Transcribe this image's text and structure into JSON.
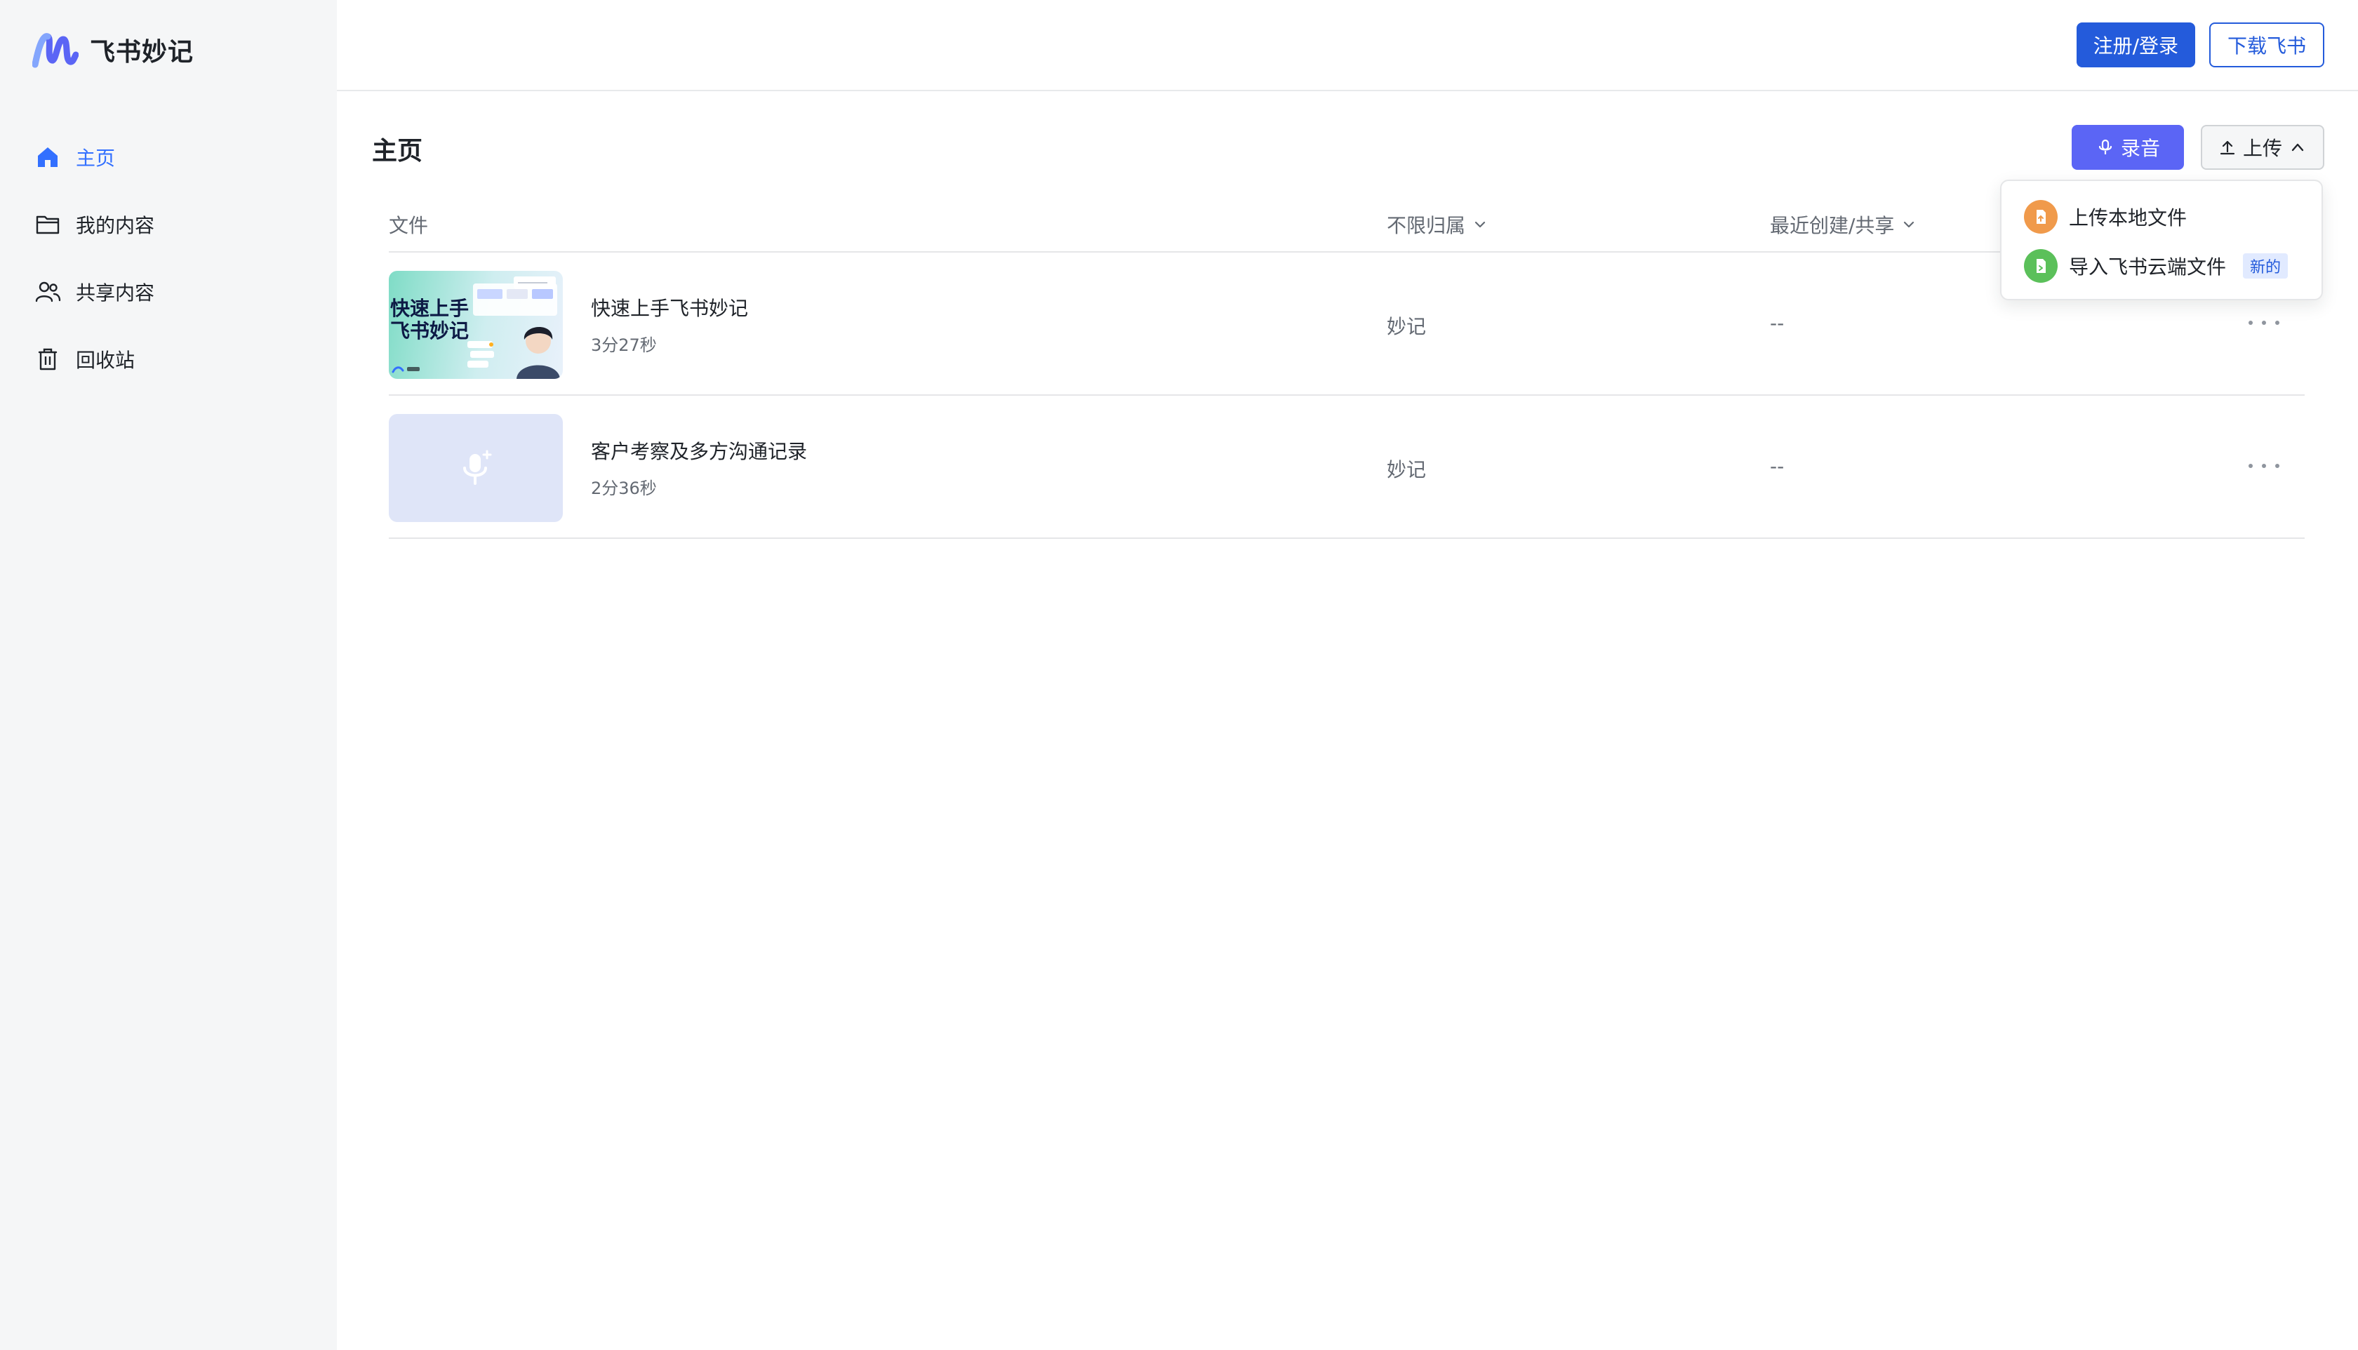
{
  "brand": {
    "name": "飞书妙记"
  },
  "sidebar": {
    "items": [
      {
        "label": "主页",
        "icon": "home-icon",
        "active": true
      },
      {
        "label": "我的内容",
        "icon": "folder-icon",
        "active": false
      },
      {
        "label": "共享内容",
        "icon": "users-icon",
        "active": false
      },
      {
        "label": "回收站",
        "icon": "trash-icon",
        "active": false
      }
    ]
  },
  "topbar": {
    "login_label": "注册/登录",
    "download_label": "下载飞书"
  },
  "main": {
    "title": "主页",
    "record_label": "录音",
    "upload_label": "上传",
    "columns": {
      "file": "文件",
      "owner": "不限归属",
      "created": "最近创建/共享"
    },
    "rows": [
      {
        "title": "快速上手飞书妙记",
        "duration": "3分27秒",
        "owner": "妙记",
        "shared": "--",
        "thumb_text": "快速上手\n飞书妙记"
      },
      {
        "title": "客户考察及多方沟通记录",
        "duration": "2分36秒",
        "owner": "妙记",
        "shared": "--"
      }
    ]
  },
  "upload_menu": {
    "items": [
      {
        "label": "上传本地文件",
        "badge": ""
      },
      {
        "label": "导入飞书云端文件",
        "badge": "新的"
      }
    ]
  },
  "colors": {
    "accent": "#3370ff",
    "primary_button": "#245bdb",
    "record_button": "#5b65f5"
  }
}
